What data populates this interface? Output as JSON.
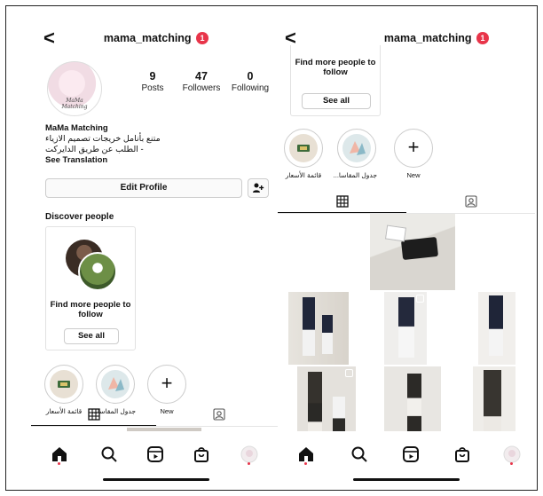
{
  "left": {
    "back_glyph": "<",
    "username": "mama_matching",
    "notification_count": "1",
    "avatar_signature": "MaMa Matching",
    "stats": [
      {
        "num": "9",
        "label": "Posts"
      },
      {
        "num": "47",
        "label": "Followers"
      },
      {
        "num": "0",
        "label": "Following"
      }
    ],
    "bio": {
      "name": "MaMa Matching",
      "line1": "متنع بأنامل خريجات تصميم الازياء",
      "line2": "- الطلب عن طريق الدايركت",
      "see_translation": "See Translation"
    },
    "edit_profile_label": "Edit Profile",
    "discover_heading": "Discover people",
    "discover_card": {
      "title": "Find more people to follow",
      "button": "See all"
    },
    "highlights": [
      {
        "caption": "قائمة الأسعار",
        "icon": "price-list-icon"
      },
      {
        "caption": "جدول المقاسا...",
        "icon": "size-chart-icon"
      },
      {
        "caption": "New",
        "icon": "plus-icon"
      }
    ]
  },
  "right": {
    "back_glyph": "<",
    "username": "mama_matching",
    "notification_count": "1",
    "discover_card": {
      "title": "Find more people to follow",
      "button": "See all"
    },
    "highlights": [
      {
        "caption": "قائمة الأسعار",
        "icon": "price-list-icon"
      },
      {
        "caption": "جدول المقاسا...",
        "icon": "size-chart-icon"
      },
      {
        "caption": "New",
        "icon": "plus-icon"
      }
    ]
  },
  "nav_items": [
    "home-icon",
    "search-icon",
    "reels-icon",
    "shop-icon",
    "profile-icon"
  ],
  "colors": {
    "badge": "#e8354a",
    "text": "#111111",
    "border": "#cccccc"
  }
}
